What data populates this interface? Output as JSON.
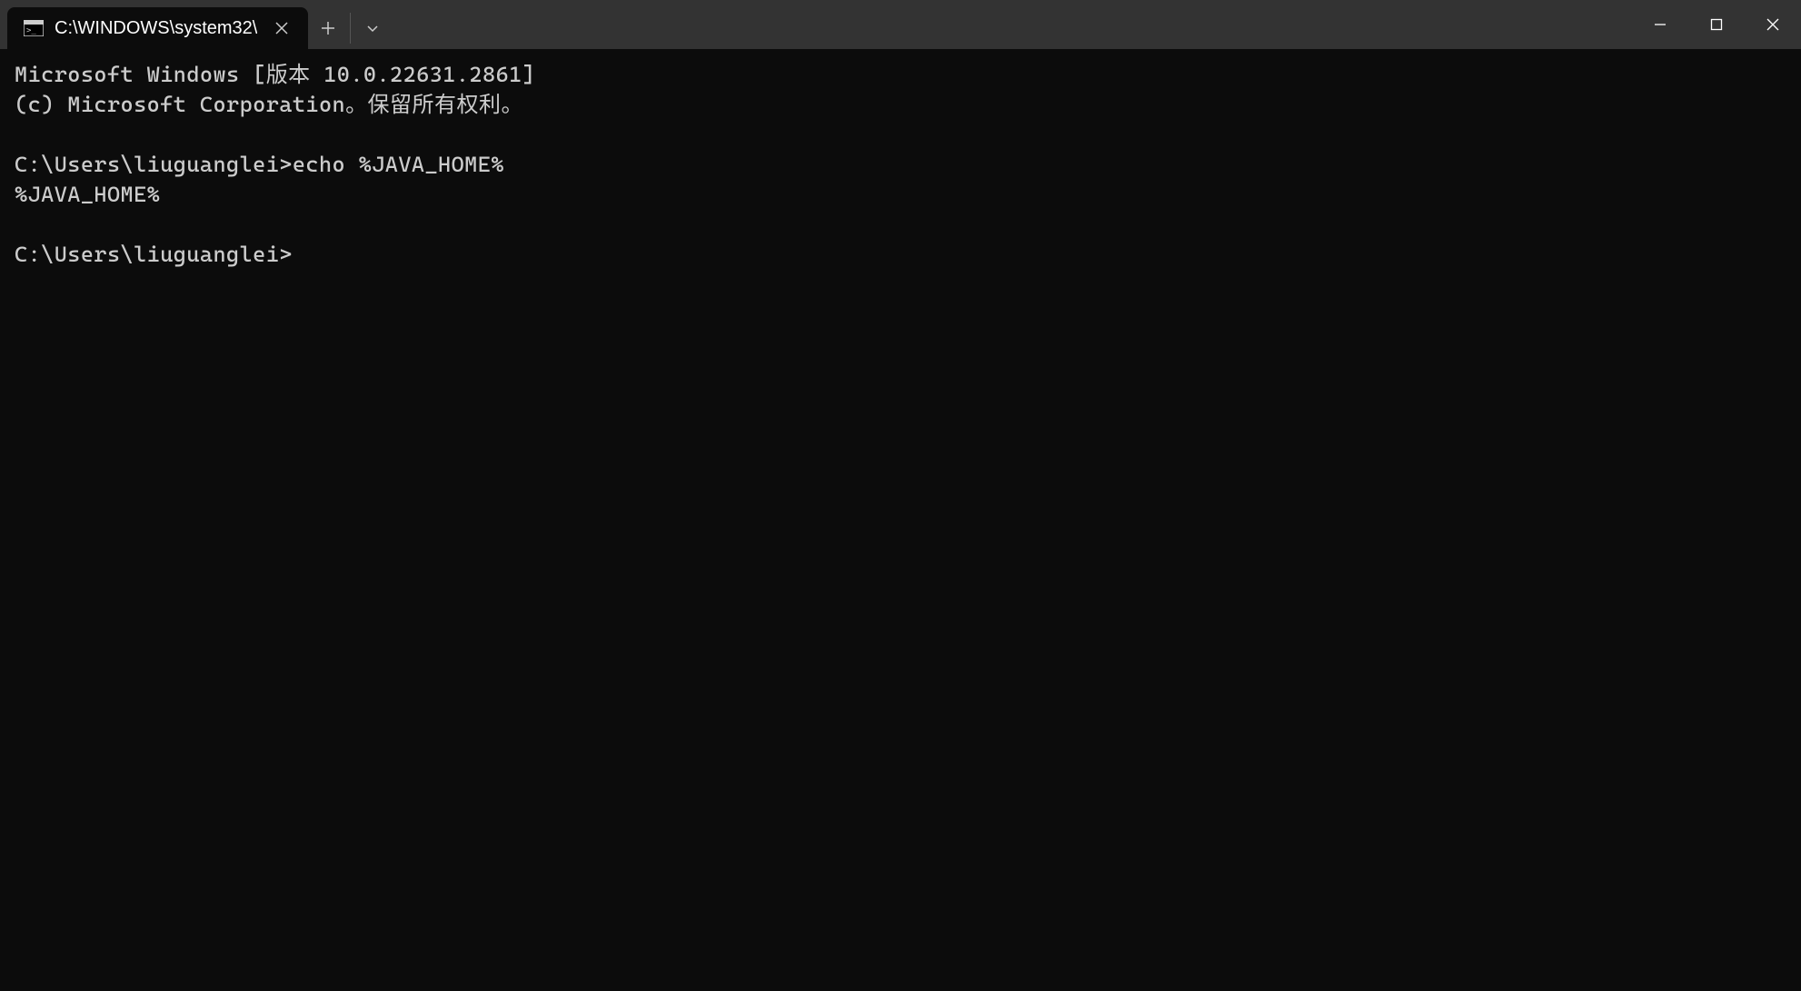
{
  "tab": {
    "title": "C:\\WINDOWS\\system32\\"
  },
  "terminal": {
    "line1": "Microsoft Windows [版本 10.0.22631.2861]",
    "line2": "(c) Microsoft Corporation。保留所有权利。",
    "blank1": "",
    "line3": "C:\\Users\\liuguanglei>echo %JAVA_HOME%",
    "line4": "%JAVA_HOME%",
    "blank2": "",
    "line5": "C:\\Users\\liuguanglei>"
  }
}
